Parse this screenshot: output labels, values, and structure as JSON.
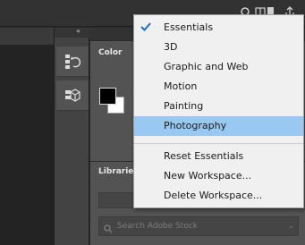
{
  "workspace_menu": {
    "items": [
      {
        "label": "Essentials",
        "checked": true
      },
      {
        "label": "3D"
      },
      {
        "label": "Graphic and Web"
      },
      {
        "label": "Motion"
      },
      {
        "label": "Painting"
      },
      {
        "label": "Photography",
        "highlighted": true
      },
      {
        "label": "Reset Essentials"
      },
      {
        "label": "New Workspace..."
      },
      {
        "label": "Delete Workspace..."
      }
    ]
  },
  "panels": {
    "color": {
      "tab_label": "Color",
      "foreground": "#000000",
      "background": "#ffffff"
    },
    "libraries": {
      "tab_label": "Libraries",
      "search_placeholder": "Search Adobe Stock"
    }
  },
  "icons": {
    "topbar": [
      "search-icon",
      "layout-icon",
      "document-icon",
      "share-icon"
    ],
    "tools": [
      "history-icon",
      "3d-cube-icon"
    ],
    "collapse": "collapse-arrows-icon"
  },
  "colors": {
    "menu_highlight": "#99c9f3",
    "check_mark": "#1e6fd0",
    "panel_bg": "#535353"
  }
}
